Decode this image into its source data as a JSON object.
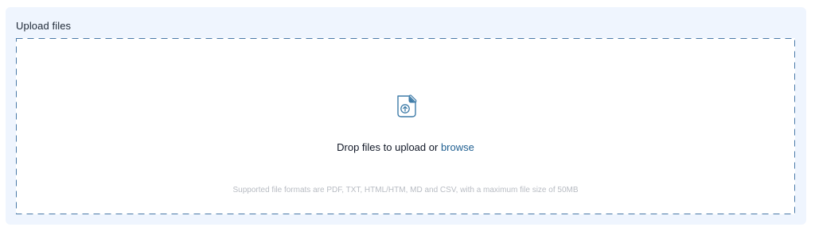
{
  "upload": {
    "title": "Upload files",
    "drop_text": "Drop files to upload or",
    "browse_label": "browse",
    "supported_text": "Supported file formats are PDF, TXT, HTML/HTM, MD and CSV, with a maximum file size of 50MB"
  },
  "icons": {
    "upload": "file-upload-icon"
  },
  "colors": {
    "panel_background": "#eff5fe",
    "dashed_border": "#4a7aa8",
    "link": "#1f5f91",
    "icon": "#3f7ca8"
  }
}
